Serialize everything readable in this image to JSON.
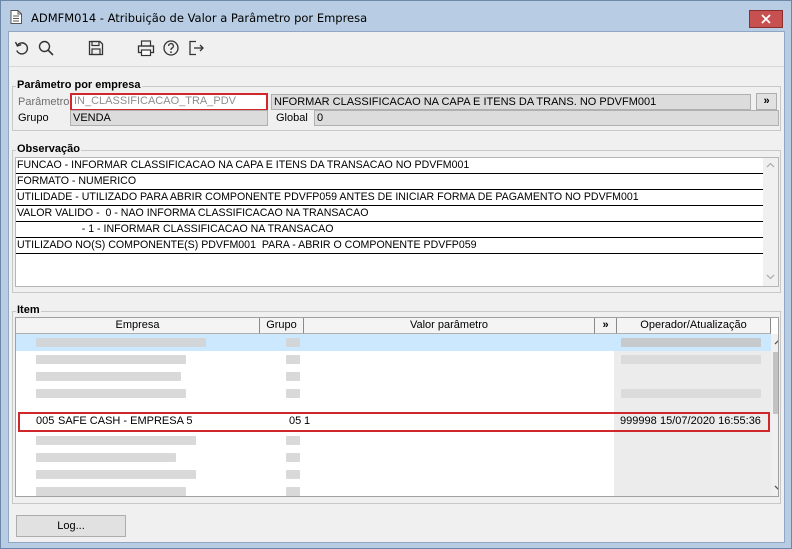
{
  "window": {
    "title": "ADMFM014 - Atribuição de Valor a Parâmetro por Empresa"
  },
  "icons": [
    "document-icon",
    "close-icon",
    "refresh-icon",
    "search-icon",
    "save-icon",
    "print-icon",
    "help-icon",
    "exit-icon",
    "double-chevron-right-icon",
    "scroll-up-icon",
    "scroll-down-icon"
  ],
  "colors": {
    "highlight": "#d0272c",
    "close_button": "#c75050",
    "row_selected": "#cce8ff"
  },
  "parametro_group": {
    "title": "Parâmetro por empresa",
    "parametro_label": "Parâmetro",
    "parametro_value": "IN_CLASSIFICACAO_TRA_PDV",
    "descricao": "NFORMAR CLASSIFICACAO NA CAPA E ITENS DA TRANS. NO PDVFM001",
    "expand_label": "»",
    "grupo_label": "Grupo",
    "grupo_value": "VENDA",
    "global_label": "Global",
    "global_value": "0"
  },
  "observacao": {
    "title": "Observação",
    "lines": [
      "FUNCAO - INFORMAR CLASSIFICACAO NA CAPA E ITENS DA TRANSACAO NO PDVFM001",
      "FORMATO - NUMERICO",
      "UTILIDADE - UTILIZADO PARA ABRIR COMPONENTE PDVFP059 ANTES DE INICIAR FORMA DE PAGAMENTO NO PDVFM001",
      "VALOR VALIDO -  0 - NAO INFORMA CLASSIFICACAO NA TRANSACAO",
      "                      - 1 - INFORMAR CLASSIFICACAO NA TRANSACAO",
      "UTILIZADO NO(S) COMPONENTE(S) PDVFM001  PARA - ABRIR O COMPONENTE PDVFP059"
    ]
  },
  "item_group": {
    "title": "Item",
    "columns": {
      "empresa": "Empresa",
      "grupo": "Grupo",
      "valor": "Valor parâmetro",
      "expand": "»",
      "operador": "Operador/Atualização"
    },
    "selected_row": {
      "codigo": "005",
      "empresa": "SAFE CASH -  EMPRESA 5",
      "grupo": "05",
      "valor": "1",
      "operador": "999998",
      "atualizacao": "15/07/2020 16:55:36"
    }
  },
  "footer": {
    "log_button": "Log..."
  }
}
